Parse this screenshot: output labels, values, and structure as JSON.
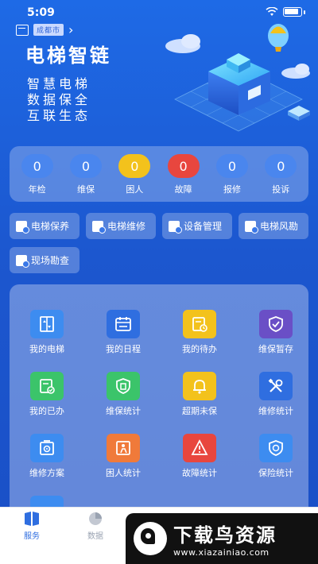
{
  "status_bar": {
    "time": "5:09"
  },
  "header": {
    "location_badge": "成都市",
    "title": "电梯智链",
    "slogans": [
      "智慧电梯",
      "数据保全",
      "互联生态"
    ]
  },
  "stats": [
    {
      "value": "0",
      "label": "年检",
      "color": "#4a86ee"
    },
    {
      "value": "0",
      "label": "维保",
      "color": "#4a86ee"
    },
    {
      "value": "0",
      "label": "困人",
      "color": "#f3c21c"
    },
    {
      "value": "0",
      "label": "故障",
      "color": "#e8463e"
    },
    {
      "value": "0",
      "label": "报修",
      "color": "#4a86ee"
    },
    {
      "value": "0",
      "label": "投诉",
      "color": "#4a86ee"
    }
  ],
  "quick_actions": [
    {
      "label": "电梯保养",
      "icon": "document-icon"
    },
    {
      "label": "电梯维修",
      "icon": "wrench-doc-icon"
    },
    {
      "label": "设备管理",
      "icon": "device-icon"
    },
    {
      "label": "电梯风勘",
      "icon": "search-doc-icon"
    },
    {
      "label": "现场勘查",
      "icon": "eye-doc-icon"
    }
  ],
  "grid": [
    {
      "label": "我的电梯",
      "icon": "elevator-icon",
      "color": "#3d8cf0"
    },
    {
      "label": "我的日程",
      "icon": "calendar-icon",
      "color": "#2f6ee0"
    },
    {
      "label": "我的待办",
      "icon": "todo-icon",
      "color": "#f3c21c"
    },
    {
      "label": "维保暂存",
      "icon": "shield-check-icon",
      "color": "#6a4fc6"
    },
    {
      "label": "我的已办",
      "icon": "done-icon",
      "color": "#3bc46a"
    },
    {
      "label": "维保统计",
      "icon": "shield-stat-icon",
      "color": "#3bc46a"
    },
    {
      "label": "超期未保",
      "icon": "bell-icon",
      "color": "#f3c21c"
    },
    {
      "label": "维修统计",
      "icon": "tools-icon",
      "color": "#2f6ee0"
    },
    {
      "label": "维修方案",
      "icon": "gear-doc-icon",
      "color": "#3d8cf0"
    },
    {
      "label": "困人统计",
      "icon": "trapped-person-icon",
      "color": "#f07a3a"
    },
    {
      "label": "故障统计",
      "icon": "warning-icon",
      "color": "#e8463e"
    },
    {
      "label": "保险统计",
      "icon": "insurance-shield-icon",
      "color": "#3d8cf0"
    }
  ],
  "tabs": [
    {
      "label": "服务",
      "icon": "service-icon",
      "active": true
    },
    {
      "label": "数据",
      "icon": "pie-chart-icon",
      "active": false
    }
  ],
  "colors": {
    "tab_active": "#2f6ee0",
    "tab_inactive": "#9aa3b2"
  },
  "watermark": {
    "title": "下载鸟资源",
    "url": "www.xiazainiao.com"
  }
}
